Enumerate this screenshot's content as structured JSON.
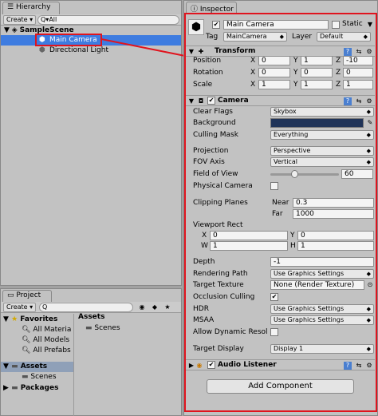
{
  "hierarchy": {
    "tab_label": "Hierarchy",
    "create_label": "Create",
    "search_placeholder": "Q▾All",
    "scene_name": "SampleScene",
    "items": [
      {
        "label": "Main Camera"
      },
      {
        "label": "Directional Light"
      }
    ]
  },
  "project": {
    "tab_label": "Project",
    "create_label": "Create",
    "favorites_label": "Favorites",
    "favorites": [
      "All Materia",
      "All Models",
      "All Prefabs"
    ],
    "assets_label": "Assets",
    "assets_children": [
      "Scenes"
    ],
    "packages_label": "Packages",
    "breadcrumb": "Assets",
    "folder_items": [
      "Scenes"
    ]
  },
  "inspector": {
    "tab_label": "Inspector",
    "object_name": "Main Camera",
    "static_label": "Static",
    "tag_label": "Tag",
    "tag_value": "MainCamera",
    "layer_label": "Layer",
    "layer_value": "Default",
    "transform": {
      "title": "Transform",
      "position_label": "Position",
      "rotation_label": "Rotation",
      "scale_label": "Scale",
      "position": {
        "x": "0",
        "y": "1",
        "z": "-10"
      },
      "rotation": {
        "x": "0",
        "y": "0",
        "z": "0"
      },
      "scale": {
        "x": "1",
        "y": "1",
        "z": "1"
      }
    },
    "camera": {
      "title": "Camera",
      "clear_flags_label": "Clear Flags",
      "clear_flags_value": "Skybox",
      "background_label": "Background",
      "background_color": "#1f3358",
      "culling_mask_label": "Culling Mask",
      "culling_mask_value": "Everything",
      "projection_label": "Projection",
      "projection_value": "Perspective",
      "fov_axis_label": "FOV Axis",
      "fov_axis_value": "Vertical",
      "fov_label": "Field of View",
      "fov_value": "60",
      "fov_slider_fraction": 0.33,
      "physical_camera_label": "Physical Camera",
      "clipping_label": "Clipping Planes",
      "near_label": "Near",
      "near_value": "0.3",
      "far_label": "Far",
      "far_value": "1000",
      "viewport_label": "Viewport Rect",
      "viewport": {
        "x": "0",
        "y": "0",
        "w": "1",
        "h": "1"
      },
      "depth_label": "Depth",
      "depth_value": "-1",
      "rendering_path_label": "Rendering Path",
      "rendering_path_value": "Use Graphics Settings",
      "target_texture_label": "Target Texture",
      "target_texture_value": "None (Render Texture)",
      "occlusion_label": "Occlusion Culling",
      "hdr_label": "HDR",
      "hdr_value": "Use Graphics Settings",
      "msaa_label": "MSAA",
      "msaa_value": "Use Graphics Settings",
      "dynamic_res_label": "Allow Dynamic Resol",
      "target_display_label": "Target Display",
      "target_display_value": "Display 1"
    },
    "audio_listener_title": "Audio Listener",
    "add_component_label": "Add Component"
  },
  "colors": {
    "selection": "#3e7ce0",
    "highlight_box": "#e0141e"
  }
}
